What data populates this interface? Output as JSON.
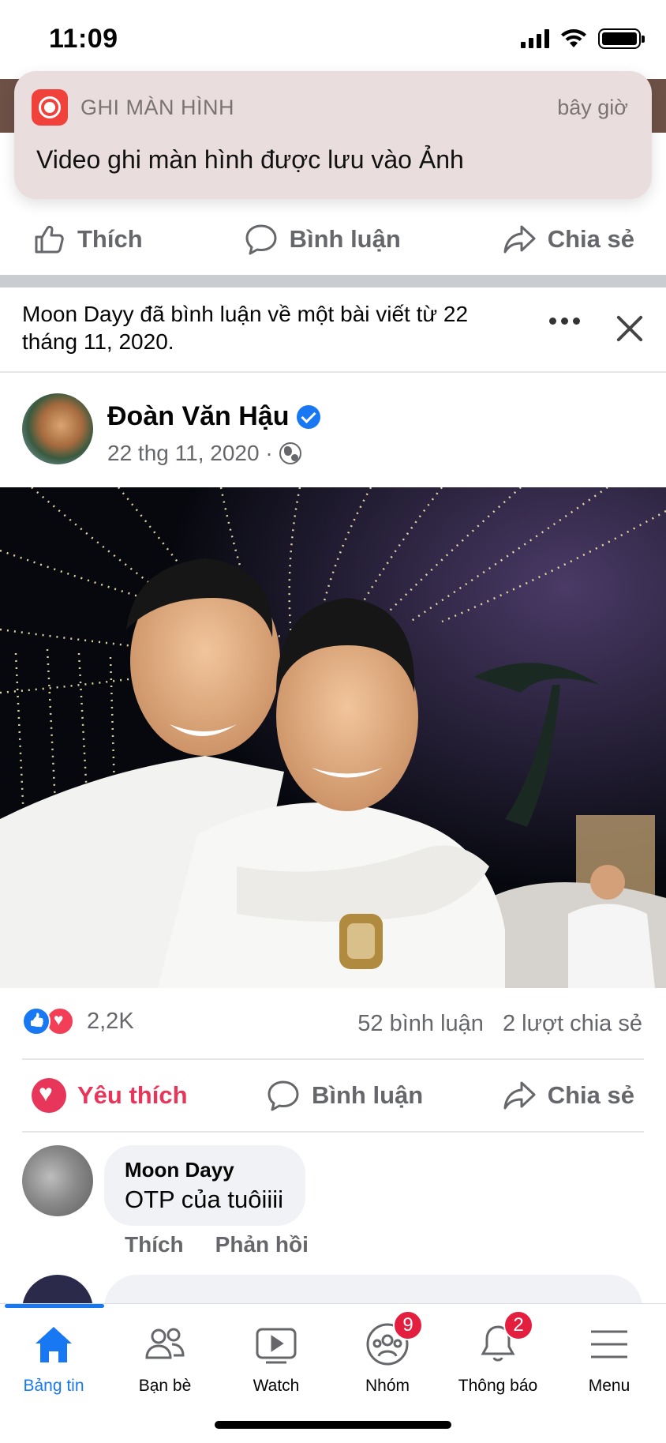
{
  "status_bar": {
    "time": "11:09"
  },
  "notification": {
    "app": "GHI MÀN HÌNH",
    "time": "bây giờ",
    "message": "Video ghi màn hình được lưu vào Ảnh"
  },
  "top_actions": {
    "like": "Thích",
    "comment": "Bình luận",
    "share": "Chia sẻ"
  },
  "activity": {
    "text": "Moon Dayy đã bình luận về một bài viết từ 22 tháng 11, 2020."
  },
  "post": {
    "author": "Đoàn Văn Hậu",
    "verified": true,
    "date": "22 thg 11, 2020 ·",
    "privacy_icon": "globe-icon",
    "reaction_count": "2,2K",
    "comment_count": "52 bình luận",
    "share_count": "2 lượt chia sẻ",
    "actions": {
      "love": "Yêu thích",
      "comment": "Bình luận",
      "share": "Chia sẻ"
    }
  },
  "comment": {
    "author": "Moon Dayy",
    "text": "OTP của tuôiiii",
    "like": "Thích",
    "reply": "Phản hồi"
  },
  "tabbar": {
    "items": [
      {
        "label": "Bảng tin",
        "icon": "home-icon",
        "active": true
      },
      {
        "label": "Bạn bè",
        "icon": "friends-icon"
      },
      {
        "label": "Watch",
        "icon": "watch-icon"
      },
      {
        "label": "Nhóm",
        "icon": "groups-icon",
        "badge": "9"
      },
      {
        "label": "Thông báo",
        "icon": "bell-icon",
        "badge": "2"
      },
      {
        "label": "Menu",
        "icon": "menu-icon"
      }
    ]
  },
  "colors": {
    "accent": "#1877f2",
    "love": "#e7365a",
    "badge": "#e41e3f",
    "muted": "#65676b"
  }
}
